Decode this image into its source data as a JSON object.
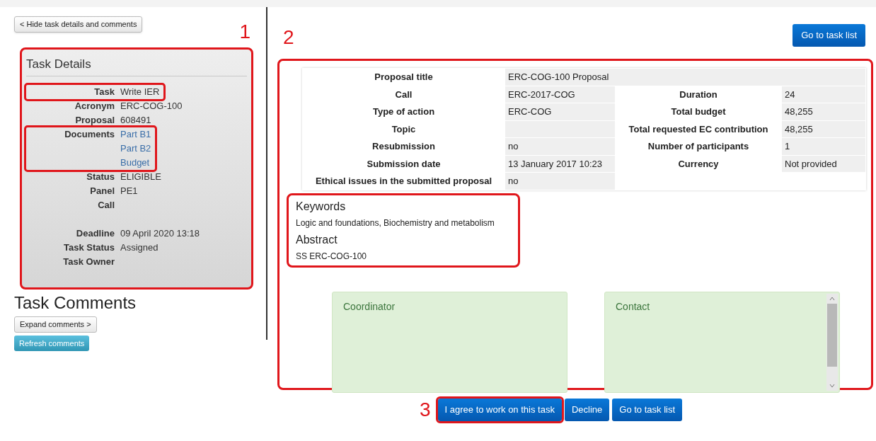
{
  "hide_button": "< Hide task details and comments",
  "task_details": {
    "callout": "1",
    "highlighted": true,
    "title": "Task Details",
    "field_groups": [
      [
        {
          "label": "Task",
          "values": [
            {
              "text": "Write IER",
              "kind": "text"
            }
          ],
          "highlighted": true
        },
        {
          "label": "Acronym",
          "values": [
            {
              "text": "ERC-COG-100",
              "kind": "text"
            }
          ],
          "highlighted": false
        },
        {
          "label": "Proposal",
          "values": [
            {
              "text": "608491",
              "kind": "text"
            }
          ],
          "highlighted": false
        },
        {
          "label": "Documents",
          "values": [
            {
              "text": "Part B1",
              "kind": "link"
            },
            {
              "text": "Part B2",
              "kind": "link"
            },
            {
              "text": "Budget",
              "kind": "link"
            }
          ],
          "highlighted": true
        },
        {
          "label": "Status",
          "values": [
            {
              "text": "ELIGIBLE",
              "kind": "text"
            }
          ],
          "highlighted": false
        },
        {
          "label": "Panel",
          "values": [
            {
              "text": "PE1",
              "kind": "text"
            }
          ],
          "highlighted": false
        },
        {
          "label": "Call",
          "highlighted": false
        }
      ],
      [
        {
          "label": "Deadline",
          "values": [
            {
              "text": "09 April 2020 13:18",
              "kind": "text"
            }
          ],
          "highlighted": false
        },
        {
          "label": "Task Status",
          "values": [
            {
              "text": "Assigned",
              "kind": "text"
            }
          ],
          "highlighted": false
        },
        {
          "label": "Task Owner",
          "highlighted": false
        }
      ]
    ]
  },
  "task_comments": {
    "title": "Task Comments",
    "expand_button": "Expand comments >",
    "refresh_button": "Refresh comments"
  },
  "top_button": "Go to task list",
  "proposal_panel": {
    "callout": "2",
    "highlighted": true,
    "title_row": {
      "label": "Proposal title",
      "value": "ERC-COG-100 Proposal"
    },
    "rows": [
      {
        "label": "Call",
        "value": "ERC-2017-COG",
        "label_2": "Duration",
        "value_2": "24"
      },
      {
        "label": "Type of action",
        "value": "ERC-COG",
        "label_2": "Total budget",
        "value_2": "48,255"
      },
      {
        "label": "Topic",
        "value": "",
        "label_2": "Total requested EC contribution",
        "value_2": "48,255"
      },
      {
        "label": "Resubmission",
        "value": "no",
        "label_2": "Number of participants",
        "value_2": "1"
      },
      {
        "label": "Submission date",
        "value": "13 January 2017 10:23",
        "label_2": "Currency",
        "value_2": "Not provided"
      },
      {
        "label": "Ethical issues in the submitted proposal",
        "value": "no"
      }
    ],
    "info": {
      "highlighted": true,
      "keywords_heading": "Keywords",
      "keywords": "Logic and foundations, Biochemistry and metabolism",
      "abstract_heading": "Abstract",
      "abstract": "SS ERC-COG-100"
    },
    "boxes": [
      {
        "title": "Coordinator",
        "scrollable": false
      },
      {
        "title": "Contact",
        "scrollable": true
      }
    ]
  },
  "actions": {
    "callout": "3",
    "buttons": [
      {
        "label": "I agree to work on this task",
        "highlighted": true
      },
      {
        "label": "Decline",
        "highlighted": false
      },
      {
        "label": "Go to task list",
        "highlighted": false
      }
    ]
  }
}
